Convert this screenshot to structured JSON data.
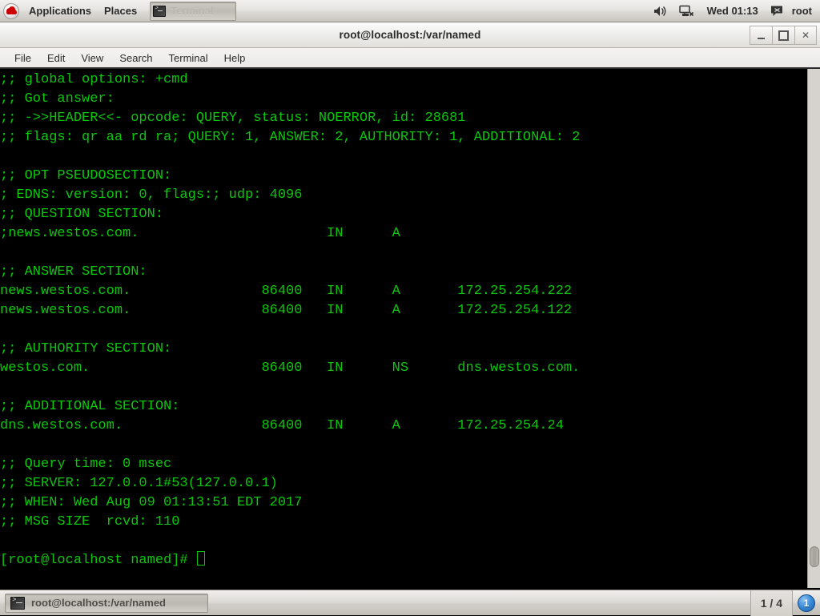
{
  "top_panel": {
    "logo_name": "red-hat-logo",
    "menus": [
      {
        "label": "Applications",
        "name": "applications-menu"
      },
      {
        "label": "Places",
        "name": "places-menu"
      }
    ],
    "window_button": {
      "label": "Terminal",
      "icon": "terminal-icon"
    },
    "tray": {
      "volume_icon": "volume-icon",
      "network_icon": "network-disconnected-icon",
      "clock": "Wed 01:13",
      "message_icon": "message-icon",
      "user": "root"
    }
  },
  "window": {
    "title": "root@localhost:/var/named",
    "buttons": {
      "minimize": "minimize-button",
      "maximize": "maximize-button",
      "close": "close-button"
    },
    "menu_bar": [
      "File",
      "Edit",
      "View",
      "Search",
      "Terminal",
      "Help"
    ]
  },
  "terminal": {
    "lines": [
      ";; global options: +cmd",
      ";; Got answer:",
      ";; ->>HEADER<<- opcode: QUERY, status: NOERROR, id: 28681",
      ";; flags: qr aa rd ra; QUERY: 1, ANSWER: 2, AUTHORITY: 1, ADDITIONAL: 2",
      "",
      ";; OPT PSEUDOSECTION:",
      "; EDNS: version: 0, flags:; udp: 4096",
      ";; QUESTION SECTION:",
      ";news.westos.com.\t\t\tIN\tA",
      "",
      ";; ANSWER SECTION:",
      "news.westos.com.\t\t86400\tIN\tA\t172.25.254.222",
      "news.westos.com.\t\t86400\tIN\tA\t172.25.254.122",
      "",
      ";; AUTHORITY SECTION:",
      "westos.com.\t\t\t86400\tIN\tNS\tdns.westos.com.",
      "",
      ";; ADDITIONAL SECTION:",
      "dns.westos.com.\t\t\t86400\tIN\tA\t172.25.254.24",
      "",
      ";; Query time: 0 msec",
      ";; SERVER: 127.0.0.1#53(127.0.0.1)",
      ";; WHEN: Wed Aug 09 01:13:51 EDT 2017",
      ";; MSG SIZE  rcvd: 110",
      ""
    ],
    "prompt": "[root@localhost named]# ",
    "dig_result": {
      "opcode": "QUERY",
      "status": "NOERROR",
      "id": "28681",
      "flags": "qr aa rd ra",
      "counts": {
        "QUERY": "1",
        "ANSWER": "2",
        "AUTHORITY": "1",
        "ADDITIONAL": "2"
      },
      "edns_version": "0",
      "udp": "4096",
      "question": {
        "name": "news.westos.com.",
        "class": "IN",
        "type": "A"
      },
      "answer": [
        {
          "name": "news.westos.com.",
          "ttl": "86400",
          "class": "IN",
          "type": "A",
          "data": "172.25.254.222"
        },
        {
          "name": "news.westos.com.",
          "ttl": "86400",
          "class": "IN",
          "type": "A",
          "data": "172.25.254.122"
        }
      ],
      "authority": [
        {
          "name": "westos.com.",
          "ttl": "86400",
          "class": "IN",
          "type": "NS",
          "data": "dns.westos.com."
        }
      ],
      "additional": [
        {
          "name": "dns.westos.com.",
          "ttl": "86400",
          "class": "IN",
          "type": "A",
          "data": "172.25.254.24"
        }
      ],
      "query_time": "0 msec",
      "server": "127.0.0.1#53(127.0.0.1)",
      "when": "Wed Aug 09 01:13:51 EDT 2017",
      "msg_size_rcvd": "110"
    },
    "foreground_color": "#0ac70a",
    "background_color": "#000000"
  },
  "bottom_panel": {
    "task_label": "root@localhost:/var/named",
    "task_icon": "terminal-icon",
    "workspace": "1 / 4",
    "notification_count": "1"
  }
}
